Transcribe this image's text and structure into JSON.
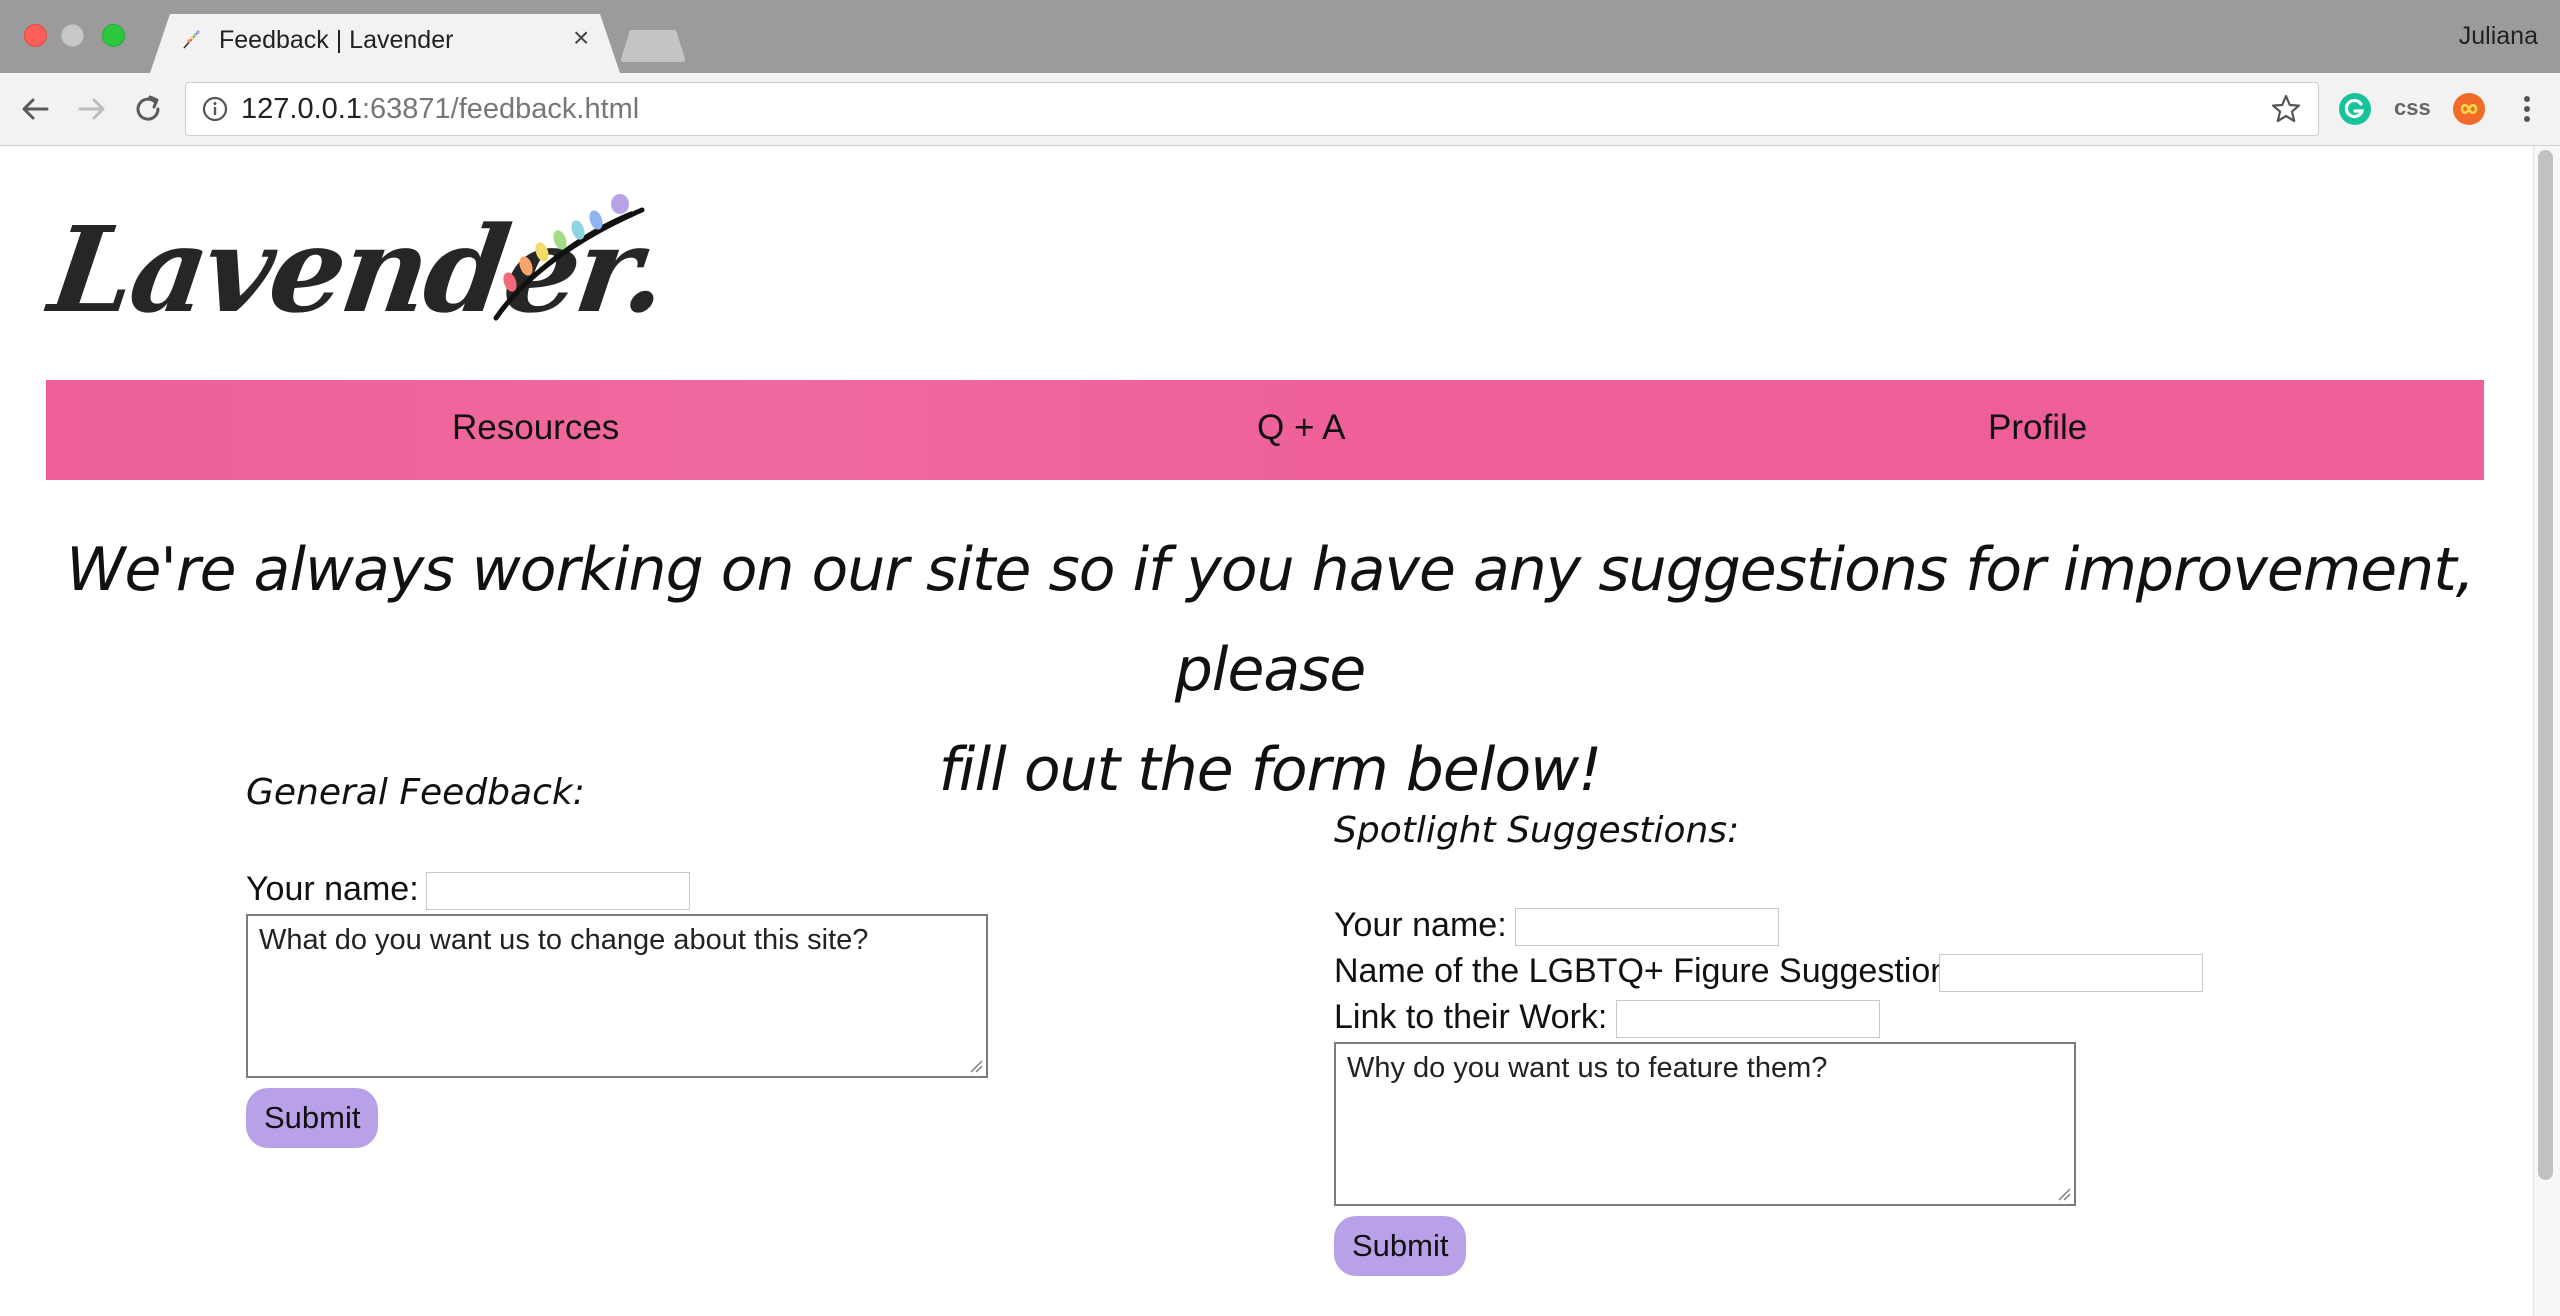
{
  "browser": {
    "tab_title": "Feedback | Lavender",
    "tab_close": "×",
    "profile_name": "Juliana",
    "url_host": "127.0.0.1",
    "url_rest": ":63871/feedback.html",
    "extensions": [
      "grammarly-icon",
      "css-icon",
      "infinity-icon",
      "more-menu-icon"
    ],
    "css_ext_label": "css"
  },
  "site": {
    "logo_text": "Lavender."
  },
  "nav": {
    "items": [
      "Resources",
      "Q + A",
      "Profile"
    ]
  },
  "main": {
    "heading_line1": "We're always working on our site so if you have any suggestions for improvement, please",
    "heading_line2": "fill out the form below!"
  },
  "general_form": {
    "title": "General Feedback:",
    "name_label": "Your name:",
    "name_value": "",
    "textarea_value": "What do you want us to change about this site?",
    "submit_label": "Submit"
  },
  "spotlight_form": {
    "title": "Spotlight Suggestions:",
    "name_label": "Your name:",
    "name_value": "",
    "figure_label": "Name of the LGBTQ+ Figure Suggestion:",
    "figure_value": "",
    "link_label": "Link to their Work:",
    "link_value": "",
    "textarea_value": "Why do you want us to feature them?",
    "submit_label": "Submit"
  },
  "colors": {
    "nav_pink": "#ee5f99",
    "submit_lavender": "#b9a1e8"
  }
}
